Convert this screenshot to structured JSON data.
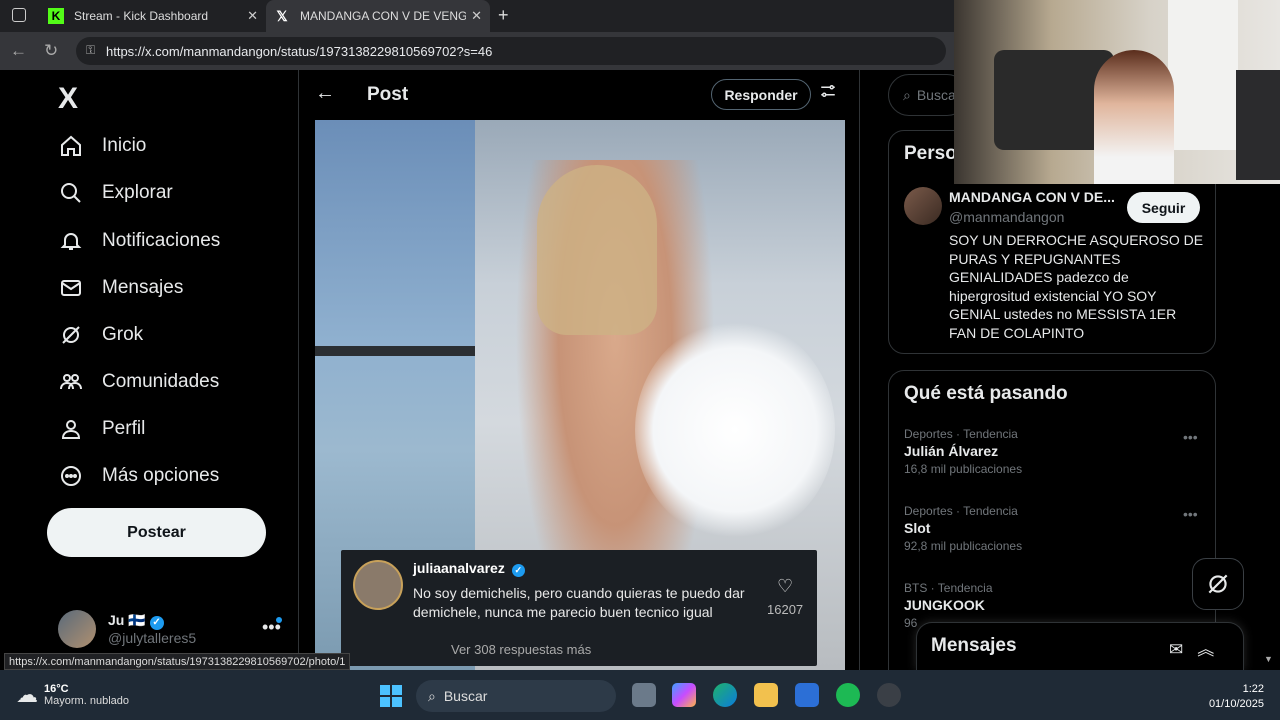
{
  "browser": {
    "tabs": [
      {
        "label": "Stream - Kick Dashboard",
        "icon": "kick-icon",
        "color": "#53fc18"
      },
      {
        "label": "MANDANGA CON V DE VENGAN",
        "icon": "x-icon"
      }
    ],
    "url": "https://x.com/manmandangon/status/1973138229810569702?s=46",
    "status_url": "https://x.com/manmandangon/status/1973138229810569702/photo/1"
  },
  "sidebar": {
    "logo": "X",
    "items": [
      {
        "label": "Inicio",
        "icon": "home-icon"
      },
      {
        "label": "Explorar",
        "icon": "search-icon"
      },
      {
        "label": "Notificaciones",
        "icon": "bell-icon"
      },
      {
        "label": "Mensajes",
        "icon": "mail-icon"
      },
      {
        "label": "Grok",
        "icon": "grok-icon"
      },
      {
        "label": "Comunidades",
        "icon": "communities-icon"
      },
      {
        "label": "Perfil",
        "icon": "person-icon"
      },
      {
        "label": "Más opciones",
        "icon": "more-circle-icon"
      }
    ],
    "post_button": "Postear",
    "account": {
      "name": "Ju 🇫🇮",
      "handle": "@julytalleres5"
    }
  },
  "main": {
    "title": "Post",
    "reply_button": "Responder",
    "comment": {
      "username": "juliaanalvarez",
      "text": "No soy demichelis, pero cuando quieras te puedo dar demichele, nunca me parecio buen tecnico igual",
      "likes": "16207",
      "more_replies": "Ver 308 respuestas más"
    }
  },
  "right": {
    "search_placeholder": "Busca",
    "person_card": {
      "title": "Perso",
      "name": "MANDANGA CON V DE...",
      "handle": "@manmandangon",
      "follow": "Seguir",
      "bio": "SOY UN DERROCHE ASQUEROSO DE PURAS Y REPUGNANTES GENIALIDADES padezco de hipergrositud existencial YO SOY GENIAL ustedes no MESSISTA 1ER FAN DE COLAPINTO"
    },
    "trends": {
      "title": "Qué está pasando",
      "items": [
        {
          "meta": "Deportes · Tendencia",
          "name": "Julián Álvarez",
          "count": "16,8 mil publicaciones"
        },
        {
          "meta": "Deportes · Tendencia",
          "name": "Slot",
          "count": "92,8 mil publicaciones"
        },
        {
          "meta": "BTS · Tendencia",
          "name": "JUNGKOOK",
          "count": "96"
        }
      ]
    },
    "messages": "Mensajes"
  },
  "taskbar": {
    "temp": "16°C",
    "weather": "Mayorm. nublado",
    "search": "Buscar",
    "time": "1:22",
    "date": "01/10/2025"
  }
}
